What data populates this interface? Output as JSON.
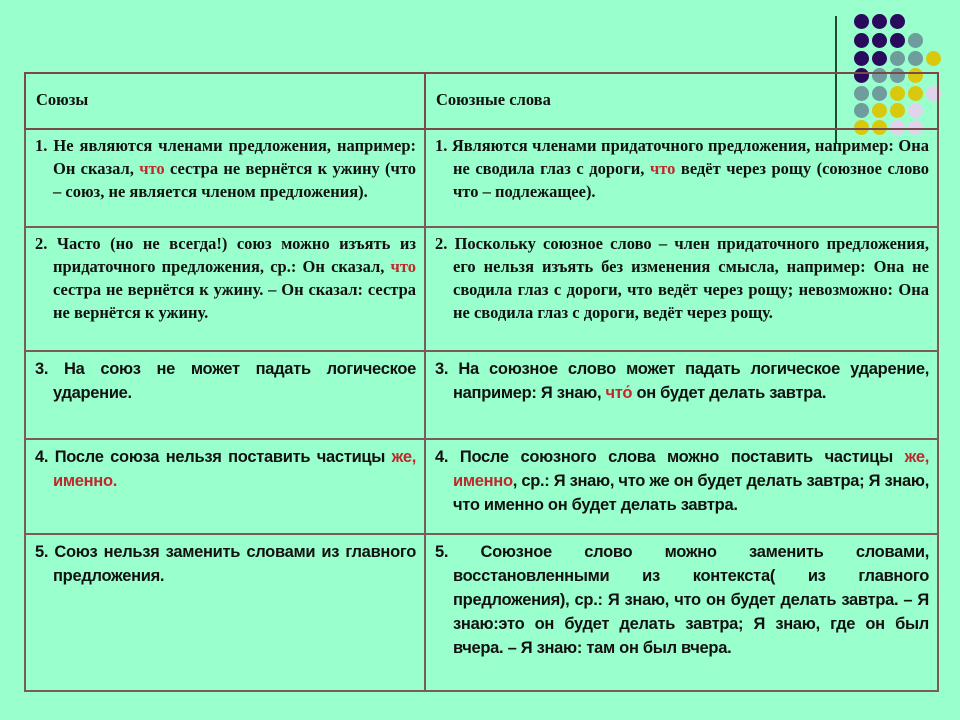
{
  "decoration": {
    "dot_colors": {
      "purple": "#2a0a5c",
      "gray": "#6f9c9c",
      "yellow": "#d8c80e",
      "pink": "#e0d4ec"
    },
    "dot_grid": [
      [
        "purple",
        "purple",
        "purple"
      ],
      [
        "purple",
        "purple",
        "purple",
        "gray"
      ],
      [
        "purple",
        "purple",
        "gray",
        "gray",
        "yellow"
      ],
      [
        "purple",
        "gray",
        "gray",
        "yellow"
      ],
      [
        "gray",
        "gray",
        "yellow",
        "yellow",
        "pink"
      ],
      [
        "gray",
        "yellow",
        "yellow",
        "pink"
      ],
      [
        "yellow",
        "yellow",
        "pink",
        "pink"
      ]
    ]
  },
  "table": {
    "headers": [
      "Союзы",
      "Союзные слова"
    ],
    "rows": [
      {
        "left": [
          {
            "t": "1. Не являются членами предложения, например: Он сказал, "
          },
          {
            "t": "что",
            "red": true
          },
          {
            "t": " сестра не вернётся к ужину (что – союз, не является членом предложения)."
          }
        ],
        "right": [
          {
            "t": "1. Являются членами придаточного предложения, например: Она не сводила глаз с дороги, "
          },
          {
            "t": "что",
            "red": true
          },
          {
            "t": " ведёт через рощу (союзное слово что – подлежащее)."
          }
        ]
      },
      {
        "left": [
          {
            "t": "2. Часто (но не всегда!) союз можно изъять из придаточного предложения, ср.: Он сказал, "
          },
          {
            "t": "что",
            "red": true
          },
          {
            "t": " сестра не вернётся к ужину. – Он сказал: сестра не вернётся к ужину."
          }
        ],
        "right": [
          {
            "t": "2. Поскольку союзное слово – член придаточного предложения, его нельзя изъять без изменения смысла, например: Она не сводила глаз с дороги, что ведёт через рощу; невозможно: Она не сводила глаз с дороги, ведёт через рощу."
          }
        ]
      },
      {
        "left": [
          {
            "t": "3. На союз не может падать логическое ударение."
          }
        ],
        "right": [
          {
            "t": "3. На союзное слово может падать логическое ударение, например: Я знаю, "
          },
          {
            "t": "что́",
            "red": true
          },
          {
            "t": " он будет делать завтра."
          }
        ]
      },
      {
        "left": [
          {
            "t": "4. После союза нельзя поставить частицы "
          },
          {
            "t": "же, именно.",
            "red": true
          }
        ],
        "right": [
          {
            "t": "4. После союзного слова можно поставить частицы "
          },
          {
            "t": "же, именно",
            "red": true
          },
          {
            "t": ", ср.: Я знаю, что же он будет делать завтра; Я знаю, что именно он будет делать завтра."
          }
        ]
      },
      {
        "left": [
          {
            "t": "5. Союз нельзя заменить словами из главного предложения."
          }
        ],
        "right": [
          {
            "t": "5. Союзное слово можно заменить словами, восстановленными из контекста( из главного предложения), ср.: Я знаю, что он будет делать завтра. – Я знаю:это он будет делать завтра; Я знаю, где он был вчера. – Я знаю: там он был вчера."
          }
        ]
      }
    ]
  }
}
